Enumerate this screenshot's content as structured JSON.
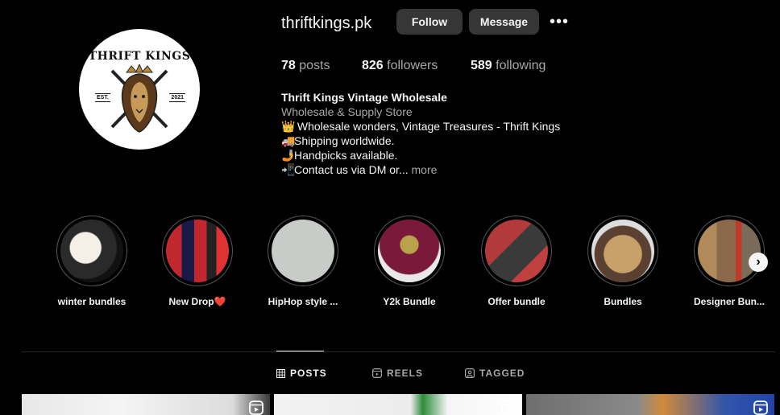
{
  "profile": {
    "username": "thriftkings.pk",
    "follow_label": "Follow",
    "message_label": "Message",
    "more_label": "•••",
    "avatar": {
      "logo_text": "THRIFT KINGS",
      "est": "EST.",
      "year": "2021"
    },
    "stats": {
      "posts_count": "78",
      "posts_label": "posts",
      "followers_count": "826",
      "followers_label": "followers",
      "following_count": "589",
      "following_label": "following"
    },
    "bio": {
      "name": "Thrift Kings Vintage Wholesale",
      "category": "Wholesale & Supply Store",
      "lines": [
        {
          "emoji": "👑",
          "text": " Wholesale wonders, Vintage Treasures - Thrift Kings"
        },
        {
          "emoji": "🚚",
          "text": "Shipping worldwide."
        },
        {
          "emoji": "🤳",
          "text": "Handpicks available."
        },
        {
          "emoji": "📲",
          "text": "Contact us via DM or..."
        }
      ],
      "more_label": "more"
    }
  },
  "highlights": [
    {
      "label": "winter bundles"
    },
    {
      "label": "New Drop❤️"
    },
    {
      "label": "HipHop style ..."
    },
    {
      "label": "Y2k Bundle"
    },
    {
      "label": "Offer bundle"
    },
    {
      "label": "Bundles"
    },
    {
      "label": "Designer Bun..."
    }
  ],
  "tabs": {
    "posts": "POSTS",
    "reels": "REELS",
    "tagged": "TAGGED"
  },
  "colors": {
    "background": "#000000",
    "button": "#363636",
    "text_primary": "#f5f5f5",
    "text_secondary": "#a8a8a8"
  }
}
